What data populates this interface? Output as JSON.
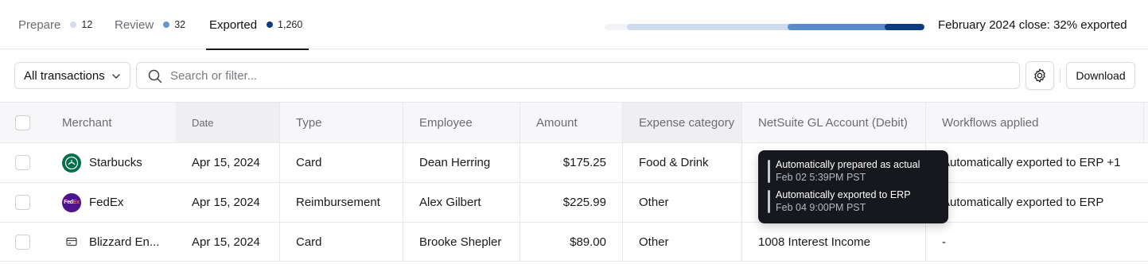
{
  "tabs": [
    {
      "label": "Prepare",
      "count": "12",
      "dot_color": "#d6dde8",
      "active": false
    },
    {
      "label": "Review",
      "count": "32",
      "dot_color": "#6a93c8",
      "active": false
    },
    {
      "label": "Exported",
      "count": "1,260",
      "dot_color": "#0b3d7e",
      "active": true
    }
  ],
  "progress": {
    "text": "February 2024 close: 32% exported",
    "segments": [
      {
        "name": "prepare",
        "color": "#cddcec"
      },
      {
        "name": "review",
        "color": "#5a8bcb"
      },
      {
        "name": "exported",
        "color": "#0b3d7e"
      }
    ]
  },
  "toolbar": {
    "filter_value": "All transactions",
    "search_placeholder": "Search or filter...",
    "settings_icon": "gear-icon",
    "download_label": "Download"
  },
  "table": {
    "headers": {
      "merchant": "Merchant",
      "date": "Date",
      "type": "Type",
      "employee": "Employee",
      "amount": "Amount",
      "category": "Expense category",
      "gl": "NetSuite GL Account (Debit)",
      "workflows": "Workflows applied"
    },
    "rows": [
      {
        "merchant": "Starbucks",
        "logo": "starbucks-logo",
        "date": "Apr 15, 2024",
        "type": "Card",
        "employee": "Dean Herring",
        "amount": "$175.25",
        "category": "Food & Drink",
        "gl": "",
        "workflows": "Automatically exported to ERP +1"
      },
      {
        "merchant": "FedEx",
        "logo": "fedex-logo",
        "logo_text": "Fed",
        "logo_text_accent": "Ex",
        "date": "Apr 15, 2024",
        "type": "Reimbursement",
        "employee": "Alex Gilbert",
        "amount": "$225.99",
        "category": "Other",
        "gl": "",
        "workflows": "Automatically exported to ERP"
      },
      {
        "merchant": "Blizzard En...",
        "logo": "card-icon",
        "date": "Apr 15, 2024",
        "type": "Card",
        "employee": "Brooke Shepler",
        "amount": "$89.00",
        "category": "Other",
        "gl": "1008 Interest Income",
        "workflows": "-"
      }
    ]
  },
  "tooltip": {
    "entries": [
      {
        "title": "Automatically prepared as actual",
        "time": "Feb 02 5:39PM PST"
      },
      {
        "title": "Automatically exported to ERP",
        "time": "Feb 04 9:00PM PST"
      }
    ]
  }
}
